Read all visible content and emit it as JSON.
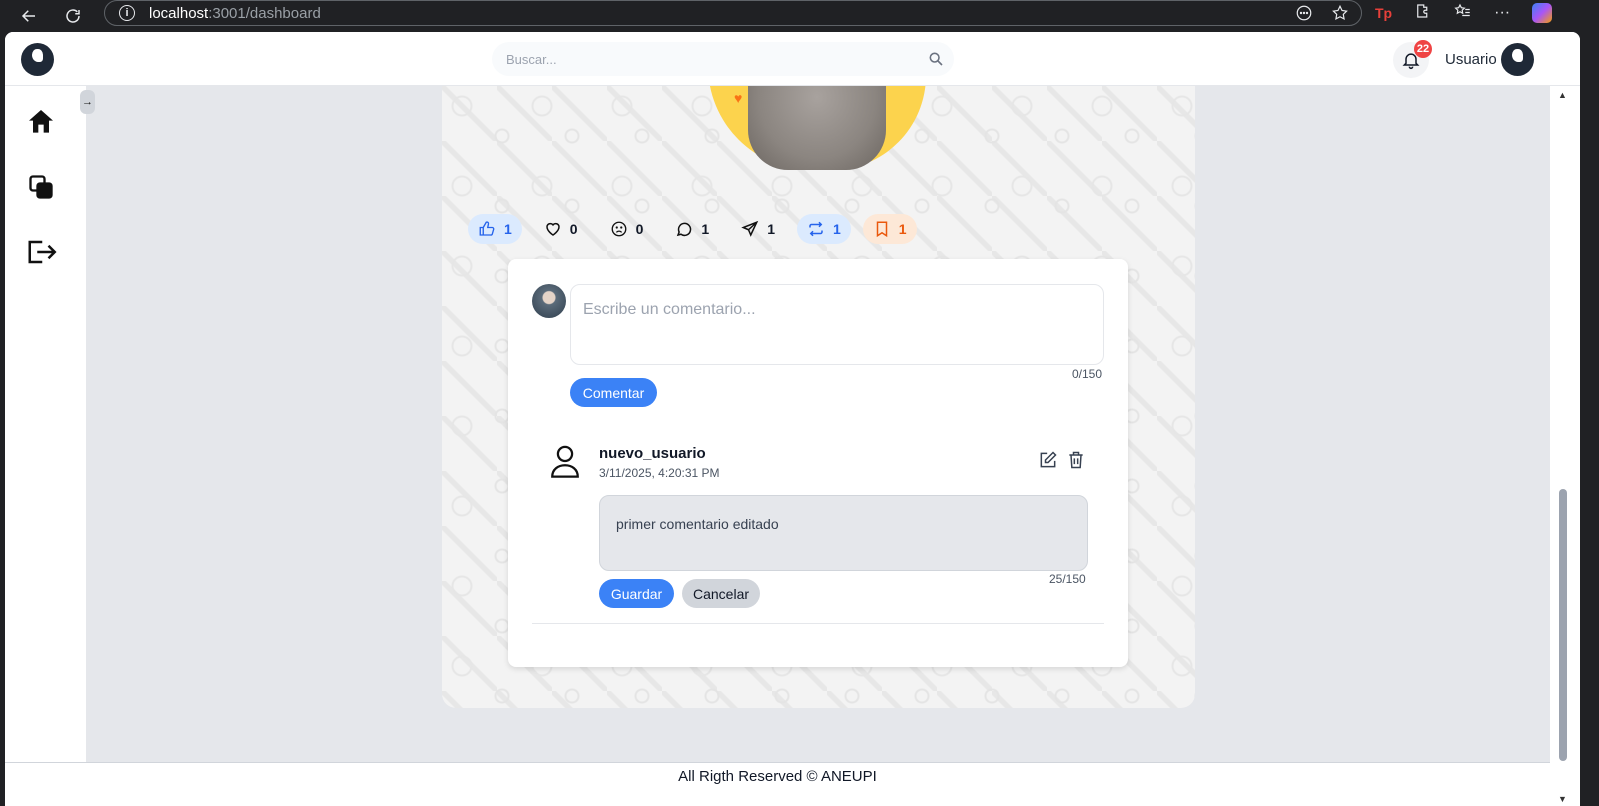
{
  "browser": {
    "url_host": "localhost",
    "url_path": ":3001/dashboard"
  },
  "topbar": {
    "search_placeholder": "Buscar...",
    "notification_count": "22",
    "user_name": "Usuario"
  },
  "sidebar": {
    "items": [
      {
        "icon": "home-icon"
      },
      {
        "icon": "layers-icon"
      },
      {
        "icon": "logout-icon"
      }
    ],
    "collapse_label": "→"
  },
  "post": {
    "reactions": [
      {
        "icon": "thumbs-up-icon",
        "count": "1",
        "active": true
      },
      {
        "icon": "heart-icon",
        "count": "0",
        "active": false
      },
      {
        "icon": "sad-face-icon",
        "count": "0",
        "active": false
      },
      {
        "icon": "comment-icon",
        "count": "1",
        "active": false
      },
      {
        "icon": "send-icon",
        "count": "1",
        "active": false
      },
      {
        "icon": "repost-icon",
        "count": "1",
        "active": true
      },
      {
        "icon": "bookmark-icon",
        "count": "1",
        "active": true
      }
    ]
  },
  "comment_form": {
    "placeholder": "Escribe un comentario...",
    "counter": "0/150",
    "submit_label": "Comentar"
  },
  "comments": [
    {
      "author": "nuevo_usuario",
      "date": "3/11/2025, 4:20:31 PM",
      "edit_text": "primer comentario editado",
      "counter": "25/150",
      "save_label": "Guardar",
      "cancel_label": "Cancelar"
    }
  ],
  "footer": {
    "text": "All Rigth Reserved © ANEUPI"
  },
  "colors": {
    "primary": "#3b82f6",
    "badge": "#ef4444",
    "bookmark": "#ea580c"
  }
}
